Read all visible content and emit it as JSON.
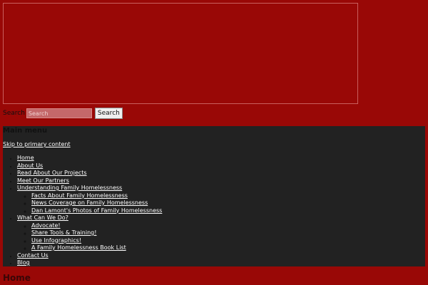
{
  "search": {
    "label": "Search",
    "placeholder": "Search",
    "button_label": "Search"
  },
  "nav": {
    "heading": "Main menu",
    "skip_link": "Skip to primary content",
    "items": [
      {
        "label": "Home"
      },
      {
        "label": "About Us"
      },
      {
        "label": "Read About Our Projects"
      },
      {
        "label": "Meet Our Partners"
      },
      {
        "label": "Understanding Family Homelessness",
        "children": [
          {
            "label": "Facts About Family Homelessness"
          },
          {
            "label": "News Coverage on Family Homelessness"
          },
          {
            "label": "Dan Lamont's Photos of Family Homelessness"
          }
        ]
      },
      {
        "label": "What Can We Do?",
        "children": [
          {
            "label": "Advocate!"
          },
          {
            "label": "Share Tools & Training!"
          },
          {
            "label": "Use Infographics!"
          },
          {
            "label": "A Family Homelessness Book List"
          }
        ]
      },
      {
        "label": "Contact Us"
      },
      {
        "label": "Blog"
      }
    ]
  },
  "page": {
    "title": "Home"
  },
  "colors": {
    "background": "#990806",
    "nav_background": "#222222",
    "link": "#ffffff"
  }
}
